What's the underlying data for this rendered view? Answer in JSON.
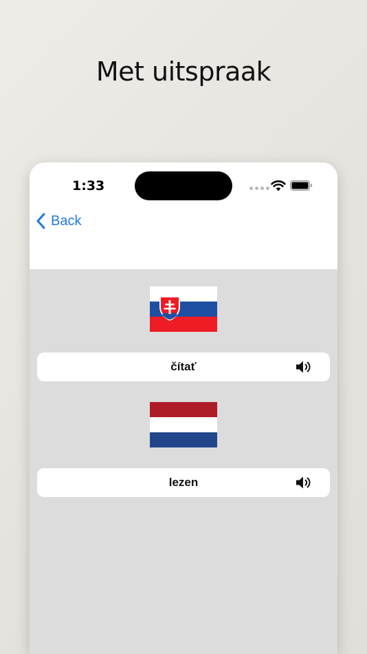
{
  "headline": "Met uitspraak",
  "status_bar": {
    "time": "1:33"
  },
  "nav": {
    "back_label": "Back"
  },
  "colors": {
    "accent": "#1f78e0",
    "content_background": "#dcdcdc",
    "card_background": "#ffffff"
  },
  "entries": [
    {
      "flag": "slovakia-flag",
      "flag_colors": [
        "#ffffff",
        "#1f4fa3",
        "#ee1c25"
      ],
      "word": "čítať",
      "audio_icon": "speaker-icon"
    },
    {
      "flag": "netherlands-flag",
      "flag_colors": [
        "#ae1c28",
        "#ffffff",
        "#21468b"
      ],
      "word": "lezen",
      "audio_icon": "speaker-icon"
    }
  ]
}
